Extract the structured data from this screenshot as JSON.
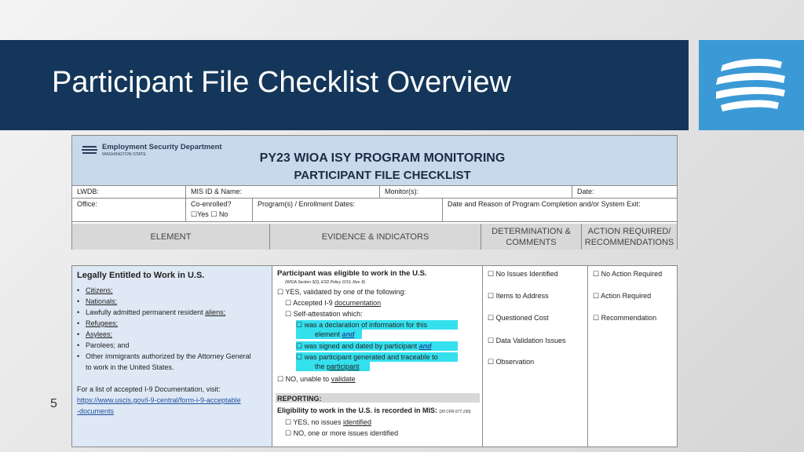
{
  "slide": {
    "title": "Participant File Checklist Overview",
    "page_number": "5",
    "accent_color": "#14365a",
    "logo_color": "#3b9ad6"
  },
  "header_doc": {
    "dept_name": "Employment Security Department",
    "dept_sub": "WASHINGTON STATE",
    "title_line1": "PY23 WIOA ISY PROGRAM MONITORING",
    "title_line2": "PARTICIPANT FILE CHECKLIST",
    "fields": {
      "lwdb": "LWDB:",
      "mis_id": "MIS ID & Name:",
      "monitor": "Monitor(s):",
      "date": "Date:",
      "office": "Office:",
      "co_enrolled": "Co-enrolled?",
      "co_enrolled_options": "☐Yes  ☐ No",
      "programs": "Program(s) / Enrollment Dates:",
      "completion": "Date and Reason of Program Completion and/or System Exit:"
    },
    "columns": {
      "element": "ELEMENT",
      "evidence": "EVIDENCE & INDICATORS",
      "determination": "DETERMINATION & COMMENTS",
      "action": "ACTION REQUIRED/ RECOMMENDATIONS"
    }
  },
  "body_doc": {
    "element": {
      "heading": "Legally Entitled to Work in U.S.",
      "items": [
        {
          "text": "Citizens;",
          "underline": true
        },
        {
          "text": "Nationals;",
          "underline": true
        },
        {
          "pre": "Lawfully admitted permanent resident ",
          "u": "aliens;"
        },
        {
          "text": "Refugees;",
          "underline": true
        },
        {
          "text": "Asylees;",
          "underline": true
        },
        {
          "text": "Parolees; and",
          "underline": false
        },
        {
          "text": "Other immigrants authorized by the Attorney General to work in the United States.",
          "underline": false
        }
      ],
      "note": "For a list of accepted I-9 Documentation, visit:",
      "link": "https://www.uscis.gov/i-9-central/form-i-9-acceptable-documents"
    },
    "evidence": {
      "heading": "Participant was eligible to work in the U.S.",
      "citation": "(WIOA Section 3(2), ESD Policy 1019, Rev. 8)",
      "yes_line": "☐ YES, validated by one of the following:",
      "i9_pre": "☐ Accepted I-9 ",
      "i9_u": "documentation",
      "self_att": "☐ Self-attestation which:",
      "hl1a": "☐ was a declaration of information for this",
      "hl1b_pre": "element ",
      "hl1b_and": "and",
      "hl2_pre": "☐ was signed and dated by participant ",
      "hl2_and": "and",
      "hl3a": "☐ was participant generated and traceable to",
      "hl3b_pre": "the ",
      "hl3b_u": "participant",
      "no_pre": "☐ NO, unable to ",
      "no_u": "validate",
      "reporting": "REPORTING:",
      "report_line": "Eligibility to work in the U.S. is recorded in MIS:",
      "report_cite": "(20 CFR 677.150)",
      "r_yes_pre": "☐ YES, no issues ",
      "r_yes_u": "identified",
      "r_no": "☐ NO, one or more issues identified"
    },
    "determination": [
      "☐ No Issues Identified",
      "☐ Items to Address",
      "☐ Questioned Cost",
      "☐ Data Validation Issues",
      "☐ Observation"
    ],
    "action": [
      "☐ No Action Required",
      "☐ Action Required",
      "☐ Recommendation"
    ]
  }
}
